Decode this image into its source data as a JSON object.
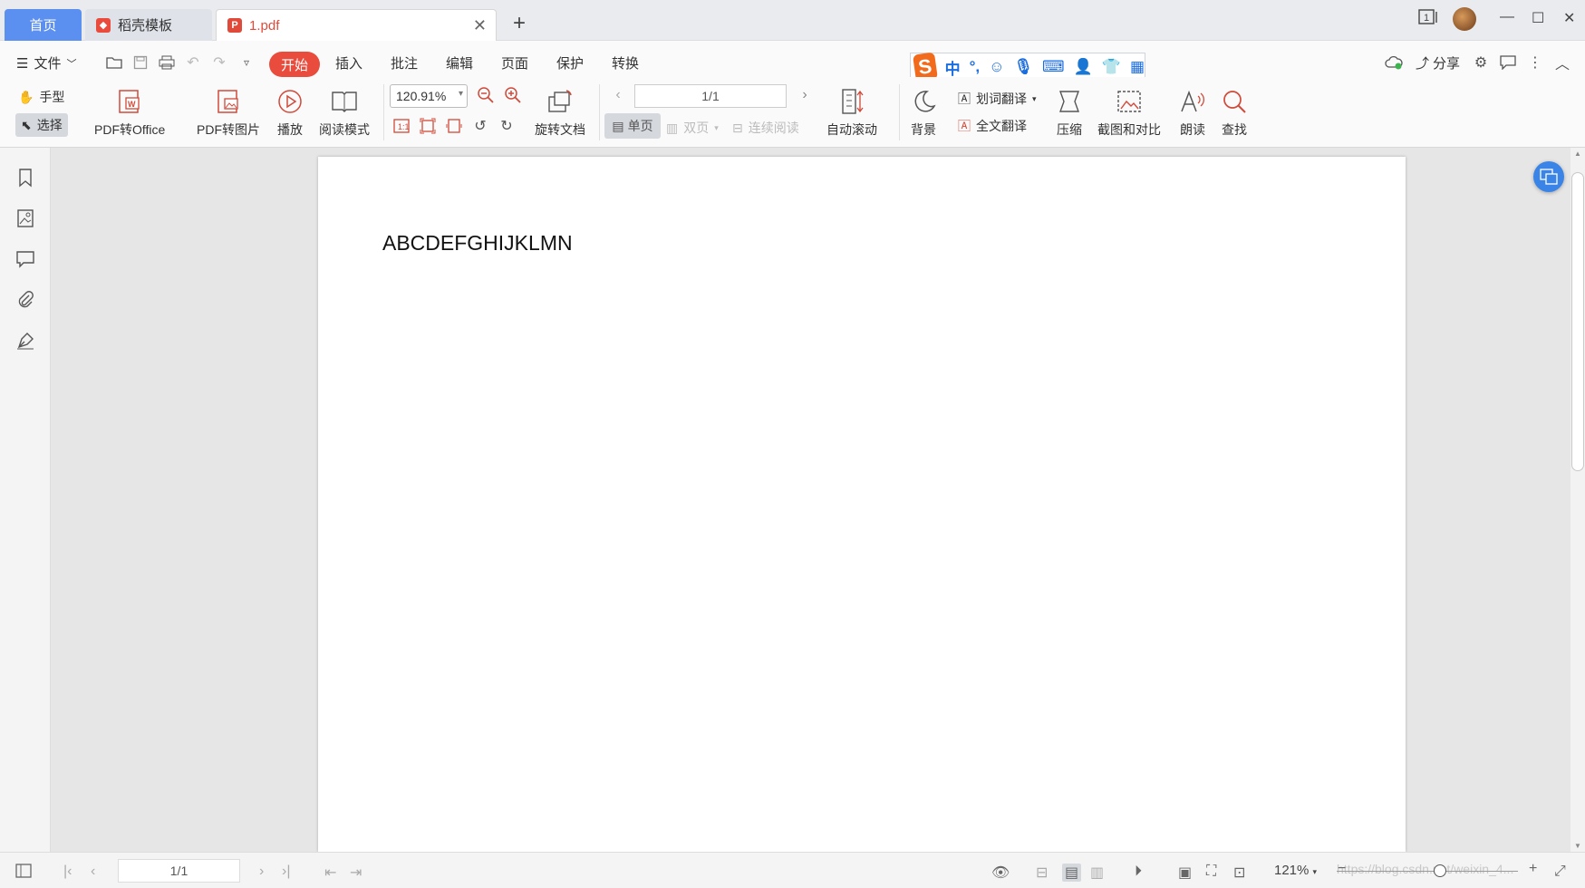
{
  "tabs": {
    "home": "首页",
    "template": "稻壳模板",
    "pdf": "1.pdf"
  },
  "menu": {
    "file": "文件",
    "items": [
      "开始",
      "插入",
      "批注",
      "编辑",
      "页面",
      "保护",
      "转换"
    ],
    "share": "分享"
  },
  "ribbon": {
    "hand": "手型",
    "select": "选择",
    "pdf_to_office": "PDF转Office",
    "pdf_to_image": "PDF转图片",
    "play": "播放",
    "read_mode": "阅读模式",
    "zoom": "120.91%",
    "rotate_doc": "旋转文档",
    "page_input": "1/1",
    "single_page": "单页",
    "double_page": "双页",
    "continuous": "连续阅读",
    "auto_scroll": "自动滚动",
    "background": "背景",
    "word_translate": "划词翻译",
    "full_translate": "全文翻译",
    "compress": "压缩",
    "screenshot_compare": "截图和对比",
    "read_aloud": "朗读",
    "find": "查找"
  },
  "ime": {
    "lang": "中",
    "punct": "°,"
  },
  "document": {
    "text": "ABCDEFGHIJKLMN"
  },
  "status": {
    "page": "1/1",
    "zoom": "121%",
    "watermark": "https://blog.csdn.net/weixin_4..."
  },
  "colors": {
    "accent": "#e94b3c",
    "home_tab": "#5b8ff0",
    "float_button": "#3a84e8"
  }
}
